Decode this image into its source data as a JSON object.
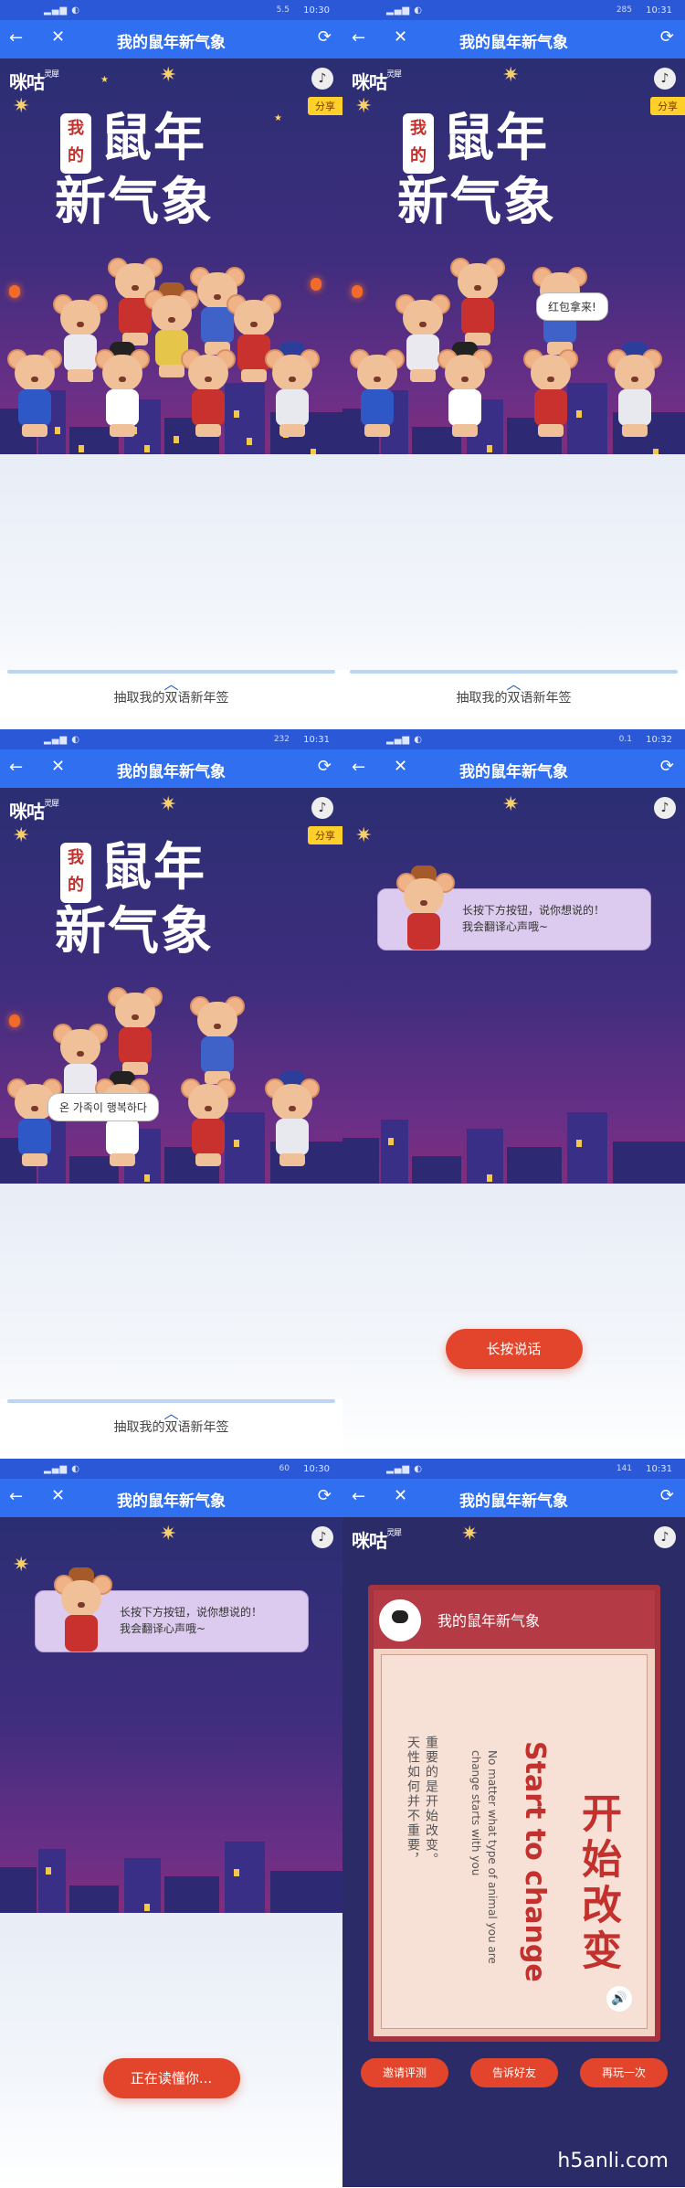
{
  "app": {
    "title": "我的鼠年新气象",
    "logo": "咪咕",
    "logo_sub": "灵犀",
    "share": "分享"
  },
  "icons": {
    "back": "arrow-left-icon",
    "close": "close-icon",
    "refresh": "refresh-icon",
    "music": "music-note-icon",
    "speaker": "speaker-icon"
  },
  "colors": {
    "nav": "#2f6ff0",
    "accent": "#e2452b",
    "night_sky": "#2a2b67",
    "share_badge": "#ffd02a"
  },
  "hero": {
    "tag": "我的",
    "line1": "鼠年",
    "line2": "新气象"
  },
  "cue": "抽取我的双语新年签",
  "screens": [
    {
      "time": "10:30",
      "speed": "5.5",
      "bubble": ""
    },
    {
      "time": "10:31",
      "speed": "285",
      "bubble": "红包拿来!"
    },
    {
      "time": "10:31",
      "speed": "232",
      "bubble": "온 가족이 행복하다"
    },
    {
      "time": "10:32",
      "speed": "0.1",
      "bubble": ""
    },
    {
      "time": "10:30",
      "speed": "60",
      "bubble": ""
    },
    {
      "time": "10:31",
      "speed": "141",
      "bubble": ""
    }
  ],
  "tip": {
    "line1": "长按下方按钮，说你想说的！",
    "line2": "我会翻译心声哦~"
  },
  "buttons": {
    "hold_to_speak": "长按说话",
    "listening": "正在读懂你...",
    "invite": "邀请评测",
    "tell_friends": "告诉好友",
    "play_again": "再玩一次"
  },
  "result": {
    "card_title": "我的鼠年新气象",
    "big_zh": "开始改变",
    "big_en": "Start to change",
    "small_en_1": "No matter what type of animal you are",
    "small_en_2": "change starts with you",
    "zh_1": "天性如何并不重要，",
    "zh_2": "重要的是开始改变。"
  },
  "watermark": "h5anli.com"
}
